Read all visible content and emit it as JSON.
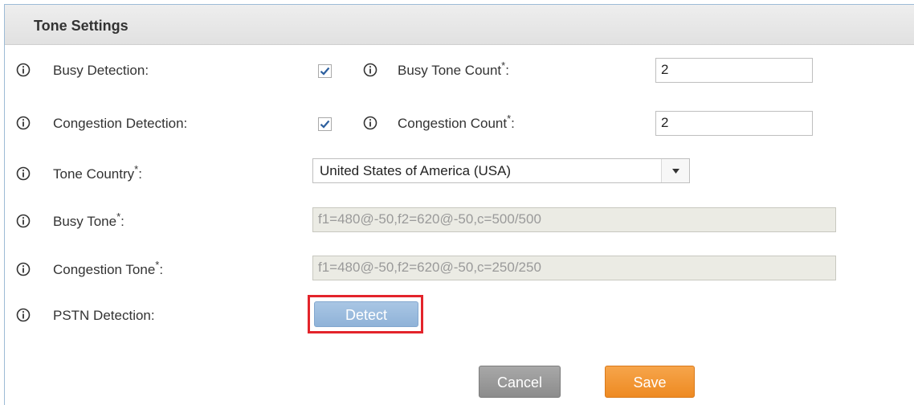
{
  "panel": {
    "title": "Tone Settings"
  },
  "fields": {
    "busy_detection": {
      "label": "Busy Detection:",
      "checked": true
    },
    "busy_tone_count": {
      "label": "Busy Tone Count",
      "required_mark": "*",
      "suffix": ":",
      "value": "2"
    },
    "congestion_detection": {
      "label": "Congestion Detection:",
      "checked": true
    },
    "congestion_count": {
      "label": "Congestion Count",
      "required_mark": "*",
      "suffix": ":",
      "value": "2"
    },
    "tone_country": {
      "label": "Tone Country",
      "required_mark": "*",
      "suffix": ":",
      "value": "United States of America (USA)"
    },
    "busy_tone": {
      "label": "Busy Tone",
      "required_mark": "*",
      "suffix": ":",
      "value": "f1=480@-50,f2=620@-50,c=500/500"
    },
    "congestion_tone": {
      "label": "Congestion Tone",
      "required_mark": "*",
      "suffix": ":",
      "value": "f1=480@-50,f2=620@-50,c=250/250"
    },
    "pstn_detection": {
      "label": "PSTN Detection:",
      "button": "Detect"
    }
  },
  "actions": {
    "cancel": "Cancel",
    "save": "Save"
  },
  "colors": {
    "accent_blue": "#8fb2d8",
    "save_orange": "#ee8a22",
    "cancel_gray": "#8c8c8c",
    "highlight_red": "#e3242b",
    "check_blue": "#2d5f9e"
  },
  "icons": {
    "info": "info-circle-icon",
    "check": "checkmark-icon",
    "dropdown": "triangle-down-icon"
  }
}
